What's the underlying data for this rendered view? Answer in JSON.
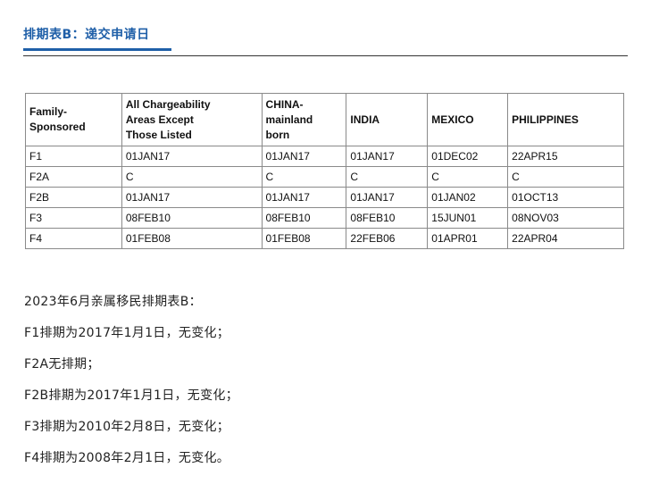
{
  "header": {
    "title": "排期表B：递交申请日"
  },
  "table": {
    "headers": [
      "Family-\nSponsored",
      "All Chargeability\nAreas Except\nThose Listed",
      "CHINA-\nmainland\nborn",
      "INDIA",
      "MEXICO",
      "PHILIPPINES"
    ],
    "rows": [
      [
        "F1",
        "01JAN17",
        "01JAN17",
        "01JAN17",
        "01DEC02",
        "22APR15"
      ],
      [
        "F2A",
        "C",
        "C",
        "C",
        "C",
        "C"
      ],
      [
        "F2B",
        "01JAN17",
        "01JAN17",
        "01JAN17",
        "01JAN02",
        "01OCT13"
      ],
      [
        "F3",
        "08FEB10",
        "08FEB10",
        "08FEB10",
        "15JUN01",
        "08NOV03"
      ],
      [
        "F4",
        "01FEB08",
        "01FEB08",
        "22FEB06",
        "01APR01",
        "22APR04"
      ]
    ]
  },
  "summary": {
    "lines": [
      "2023年6月亲属移民排期表B：",
      "F1排期为2017年1月1日，无变化；",
      "F2A无排期；",
      "F2B排期为2017年1月1日，无变化；",
      "F3排期为2010年2月8日，无变化；",
      "F4排期为2008年2月1日，无变化。"
    ]
  }
}
